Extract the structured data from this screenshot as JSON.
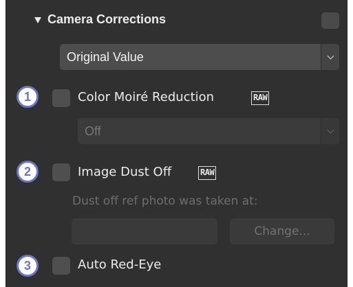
{
  "section": {
    "title": "Camera Corrections",
    "collapse_icon": "triangle-down-icon",
    "header_checkbox_checked": false
  },
  "mode_select": {
    "value": "Original Value"
  },
  "color_moire": {
    "callout": "1",
    "label": "Color Moiré Reduction",
    "badge": "RAW",
    "checked": false,
    "select_value": "Off",
    "select_enabled": false
  },
  "dust_off": {
    "callout": "2",
    "label": "Image Dust Off",
    "badge": "RAW",
    "checked": false,
    "ref_text": "Dust off ref photo was taken at:",
    "ref_value": "",
    "change_label": "Change...",
    "enabled": false
  },
  "red_eye": {
    "callout": "3",
    "label": "Auto Red-Eye",
    "checked": false
  },
  "colors": {
    "panel_bg": "#303030",
    "callout_accent": "#6a76c8"
  }
}
